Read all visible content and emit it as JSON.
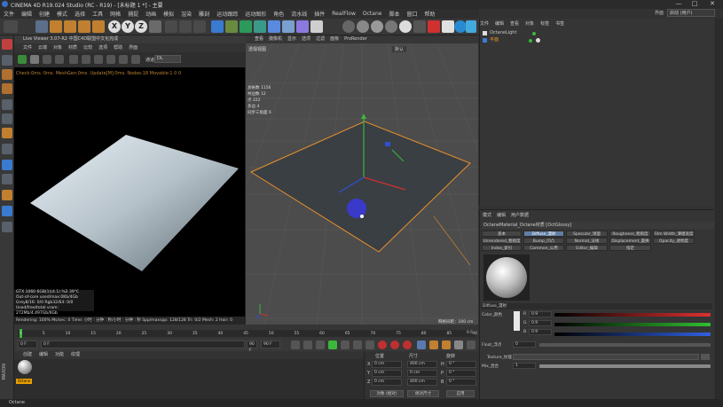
{
  "app": {
    "title": "CINEMA 4D R19.024 Studio (RC - R19) - [未标题 1 *] - 主要",
    "window_controls": [
      "—",
      "□",
      "✕"
    ]
  },
  "menubar": [
    "文件",
    "编辑",
    "创建",
    "模式",
    "选择",
    "工具",
    "网格",
    "捕捉",
    "动画",
    "模拟",
    "渲染",
    "雕刻",
    "运动跟踪",
    "运动图形",
    "角色",
    "流水线",
    "插件",
    "RealFlow",
    "Octane",
    "脚本",
    "窗口",
    "帮助"
  ],
  "layout": {
    "label": "界面",
    "value": "启动 (用户)"
  },
  "toolbar_axes": [
    "X",
    "Y",
    "Z"
  ],
  "live_viewer": {
    "header": "Live Viewer 3.07-R2 中国C4D联盟中文化完成",
    "menu": [
      "文件",
      "云端",
      "对象",
      "材质",
      "比较",
      "选项",
      "帮助",
      "界面"
    ],
    "channel": "DL",
    "status": "Check:0ms. 0ms. MeshGen:0ms. Update[M]:0ms. Nodes:18 Movable:1 0 0",
    "stats": [
      "GTX 1060 6GB(1)(4.1)     %2      39°C",
      "Out-of-core used/max:0Kb/4Gb",
      "Grey8/16: 0/0        Rgb32/64: 0/0",
      "Used/free/total vram: 272Mb/4.497Gb/6Gb"
    ],
    "render_status": "Rendering: 100%   Ms/sec: 0   Time: 小时 : 分钟 : 秒/小时 : 分钟 : 秒   Spp/maxspp: 128/128   Tri: 0/2   Mesh: 2   Hair: 0"
  },
  "viewport": {
    "menu": [
      "查看",
      "摄像机",
      "显示",
      "选项",
      "过滤",
      "面板",
      "ProRender"
    ],
    "label": "透视视图",
    "camera": "默认",
    "hud": [
      [
        "总帐数",
        "1156"
      ],
      [
        "共边数",
        "12"
      ],
      [
        "点",
        "222"
      ],
      [
        "多边",
        "4"
      ],
      [
        "同步三角面",
        "6"
      ]
    ],
    "grid_spacing": "网格间距：100 cm"
  },
  "timeline": {
    "ticks": [
      "0",
      "5",
      "10",
      "15",
      "20",
      "25",
      "30",
      "35",
      "40",
      "45",
      "50",
      "55",
      "60",
      "65",
      "70",
      "75",
      "80",
      "85",
      "90"
    ],
    "current_frame": "0 F",
    "start": "0 F",
    "end": "90 F",
    "end2": "90 F",
    "fps_box": "0 F"
  },
  "material_manager": {
    "menu": [
      "创建",
      "编辑",
      "功能",
      "纹理"
    ],
    "material_name": "Octane"
  },
  "coordinates": {
    "headers": [
      "位置",
      "尺寸",
      "旋转"
    ],
    "rows": [
      {
        "axis": "X",
        "pos": "0 cm",
        "size": "400 cm",
        "rot_axis": "H",
        "rot": "0 °"
      },
      {
        "axis": "Y",
        "pos": "0 cm",
        "size": "0 cm",
        "rot_axis": "P",
        "rot": "0 °"
      },
      {
        "axis": "Z",
        "pos": "0 cm",
        "size": "400 cm",
        "rot_axis": "B",
        "rot": "0 °"
      }
    ],
    "mode": "对象 (相对)",
    "size_mode": "绝对尺寸",
    "apply": "应用"
  },
  "object_manager": {
    "menu": [
      "文件",
      "编辑",
      "查看",
      "对象",
      "标签",
      "书签"
    ],
    "items": [
      {
        "name": "OctaneLight"
      },
      {
        "name": "平面"
      }
    ]
  },
  "attributes": {
    "menu": [
      "模式",
      "编辑",
      "用户数据"
    ],
    "title": "OctaneMaterial_Octane材质 [OctGlossy]",
    "tabs_row1": [
      "基本",
      "Diffuse_漫射",
      "Specular_镜面",
      "Roughness_粗糙度",
      "Film Width_薄膜宽度"
    ],
    "tabs_row2": [
      "Unrendered_粗糙度指数",
      "Bump_凹凸",
      "Normal_法线",
      "Displacement_置换",
      "Opacity_透明度"
    ],
    "tabs_row3": [
      "Index_索引",
      "Common_公用",
      "Editor_编辑",
      "指定"
    ],
    "active_tab": "Diffuse_漫射",
    "section": "Diffuse_漫射",
    "color_label": "Color_颜色",
    "rgb": [
      {
        "c": "R",
        "v": "0.9",
        "color": "#e03030"
      },
      {
        "c": "G",
        "v": "0.9",
        "color": "#30c030"
      },
      {
        "c": "B",
        "v": "0.9",
        "color": "#3060e0"
      }
    ],
    "float_label": "Float_浮点",
    "float_value": "0",
    "texture_label": "Texture_纹理",
    "mix_label": "Mix_混合",
    "mix_value": "1"
  },
  "statusbar": "Octane"
}
